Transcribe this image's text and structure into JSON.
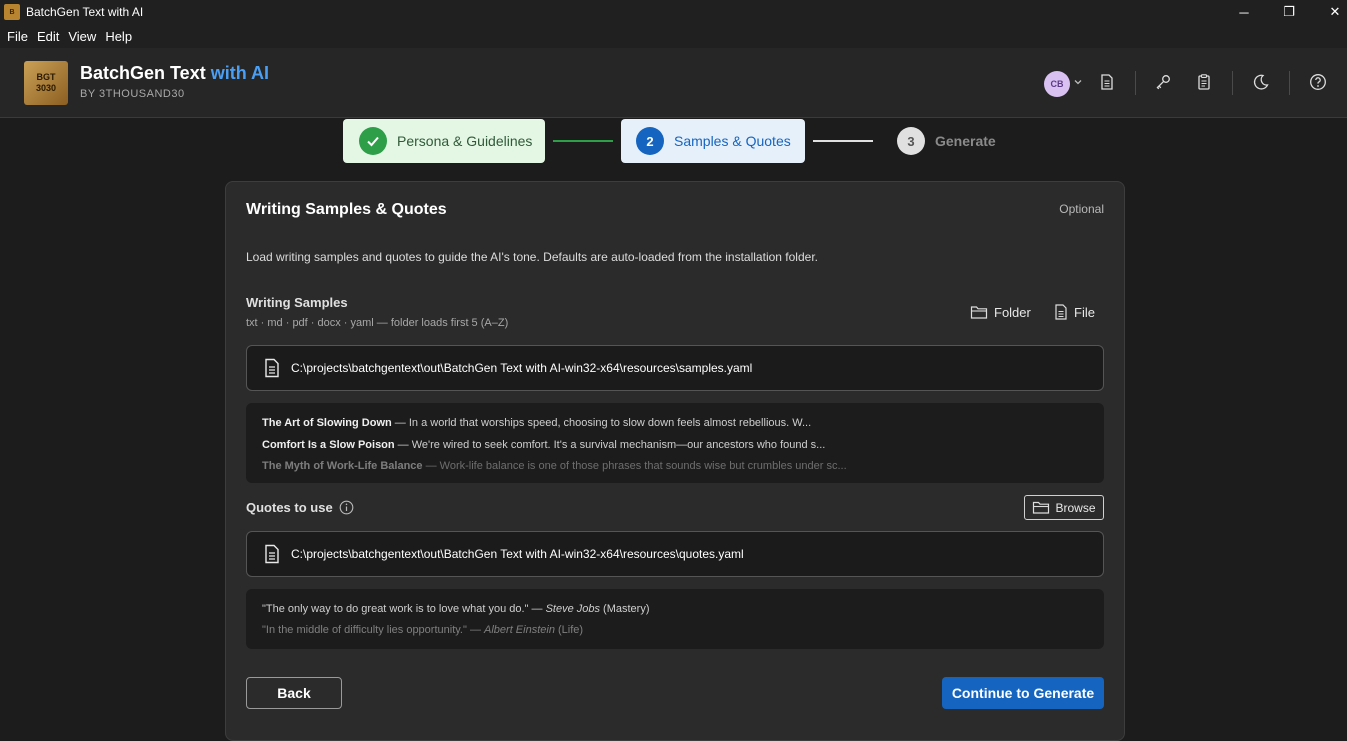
{
  "window": {
    "title": "BatchGen Text with AI",
    "controls": {
      "minimize": "─",
      "maximize": "❐",
      "close": "✕"
    }
  },
  "menu": [
    "File",
    "Edit",
    "View",
    "Help"
  ],
  "header": {
    "logo_line1": "BGT",
    "logo_line2": "3030",
    "brand_main": "BatchGen Text",
    "brand_accent": " with AI",
    "byline": "BY 3THOUSAND30",
    "avatar_initials": "CB",
    "icons": [
      "document-icon",
      "key-icon",
      "clipboard-icon",
      "moon-icon",
      "help-icon"
    ]
  },
  "stepper": {
    "steps": [
      {
        "number": "✓",
        "label": "Persona & Guidelines",
        "state": "complete"
      },
      {
        "number": "2",
        "label": "Samples & Quotes",
        "state": "active"
      },
      {
        "number": "3",
        "label": "Generate",
        "state": "pending"
      }
    ],
    "colors": {
      "complete_bg": "#e4f7e4",
      "complete_circle": "#2e9e48",
      "active_bg": "#e6f0fb",
      "active_circle": "#1565c0",
      "pending_circle": "#e0e0e0"
    }
  },
  "card": {
    "title": "Writing Samples & Quotes",
    "optional_label": "Optional",
    "description": "Load writing samples and quotes to guide the AI's tone. Defaults are auto-loaded from the installation folder.",
    "samples": {
      "title": "Writing Samples",
      "subtitle": "txt · md · pdf · docx · yaml — folder loads first 5 (A–Z)",
      "folder_label": "Folder",
      "file_label": "File",
      "path": "C:\\projects\\batchgentext\\out\\BatchGen Text with AI-win32-x64\\resources\\samples.yaml",
      "preview": [
        {
          "title": "The Art of Slowing Down",
          "excerpt": " — In a world that worships speed, choosing to slow down feels almost rebellious. W..."
        },
        {
          "title": "Comfort Is a Slow Poison",
          "excerpt": " — We're wired to seek comfort. It's a survival mechanism—our ancestors who found s..."
        },
        {
          "title": "The Myth of Work-Life Balance",
          "excerpt": " — Work-life balance is one of those phrases that sounds wise but crumbles under sc..."
        }
      ]
    },
    "quotes": {
      "title": "Quotes to use",
      "browse_label": "Browse",
      "path": "C:\\projects\\batchgentext\\out\\BatchGen Text with AI-win32-x64\\resources\\quotes.yaml",
      "preview": [
        {
          "quote": "\"The only way to do great work is to love what you do.\" — ",
          "author": "Steve Jobs",
          "tag": " (Mastery)"
        },
        {
          "quote": "\"In the middle of difficulty lies opportunity.\" — ",
          "author": "Albert Einstein",
          "tag": " (Life)"
        }
      ]
    },
    "back_label": "Back",
    "continue_label": "Continue to Generate"
  }
}
